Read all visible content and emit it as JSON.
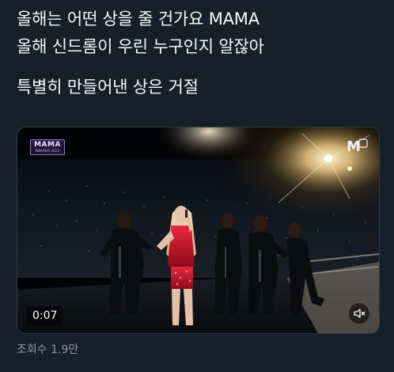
{
  "tweet": {
    "lines": [
      "올해는 어떤 상을 줄 건가요 MAMA",
      "올해 신드롬이 우린 누구인지 알잖아",
      "특별히 만들어낸 상은 거절"
    ]
  },
  "video": {
    "duration": "0:07",
    "logo_text": "MAMA",
    "logo_subtext": "AWARDS 2023",
    "broadcaster_logo": "M",
    "muted": true,
    "mute_icon": "speaker-muted-icon"
  },
  "footer": {
    "views": "조회수 1.9만"
  },
  "colors": {
    "background": "#15202b",
    "text_primary": "#f7f9f9",
    "text_secondary": "#8b98a5",
    "stage_red": "#c8102e"
  }
}
